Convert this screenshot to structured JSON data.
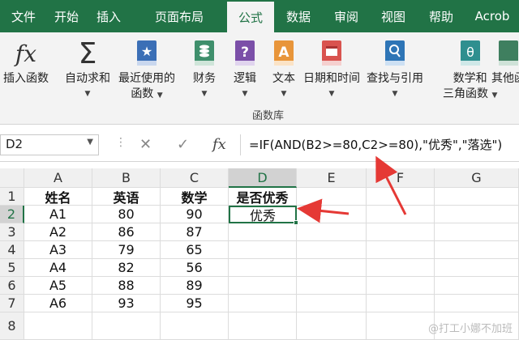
{
  "tabs": [
    "文件",
    "开始",
    "插入",
    "页面布局",
    "公式",
    "数据",
    "审阅",
    "视图",
    "帮助",
    "Acrob"
  ],
  "ribbon": {
    "buttons": [
      {
        "label1": "插入函数",
        "label2": "",
        "caret": false,
        "icon": "fx-icon"
      },
      {
        "label1": "自动求和",
        "label2": "",
        "caret": true,
        "icon": "sigma-icon"
      },
      {
        "label1": "最近使用的",
        "label2": "函数",
        "caret": true,
        "icon": "star-book-icon"
      },
      {
        "label1": "财务",
        "label2": "",
        "caret": true,
        "icon": "finance-book-icon"
      },
      {
        "label1": "逻辑",
        "label2": "",
        "caret": true,
        "icon": "logic-book-icon"
      },
      {
        "label1": "文本",
        "label2": "",
        "caret": true,
        "icon": "text-book-icon"
      },
      {
        "label1": "日期和时间",
        "label2": "",
        "caret": true,
        "icon": "calendar-book-icon"
      },
      {
        "label1": "查找与引用",
        "label2": "",
        "caret": true,
        "icon": "lookup-book-icon"
      },
      {
        "label1": "数学和",
        "label2": "三角函数",
        "caret": true,
        "icon": "math-book-icon"
      },
      {
        "label1": "其他函",
        "label2": "",
        "caret": true,
        "icon": "more-book-icon"
      }
    ],
    "group_label": "函数库"
  },
  "formula_bar": {
    "name_box": "D2",
    "cancel_icon": "✕",
    "enter_icon": "✓",
    "fx_label": "fx",
    "formula": "=IF(AND(B2>=80,C2>=80),\"优秀\",\"落选\")"
  },
  "sheet": {
    "columns": [
      "A",
      "B",
      "C",
      "D",
      "E",
      "F",
      "G"
    ],
    "rows": [
      "1",
      "2",
      "3",
      "4",
      "5",
      "6",
      "7",
      "8"
    ],
    "header_row": [
      "姓名",
      "英语",
      "数学",
      "是否优秀"
    ],
    "data": [
      [
        "A1",
        "80",
        "90",
        "优秀"
      ],
      [
        "A2",
        "86",
        "87",
        ""
      ],
      [
        "A3",
        "79",
        "65",
        ""
      ],
      [
        "A4",
        "82",
        "56",
        ""
      ],
      [
        "A5",
        "88",
        "89",
        ""
      ],
      [
        "A6",
        "93",
        "95",
        ""
      ]
    ],
    "active_cell": "D2"
  },
  "watermark": "@打工小娜不加班",
  "colors": {
    "accent": "#217346",
    "arrow": "#e53935"
  }
}
